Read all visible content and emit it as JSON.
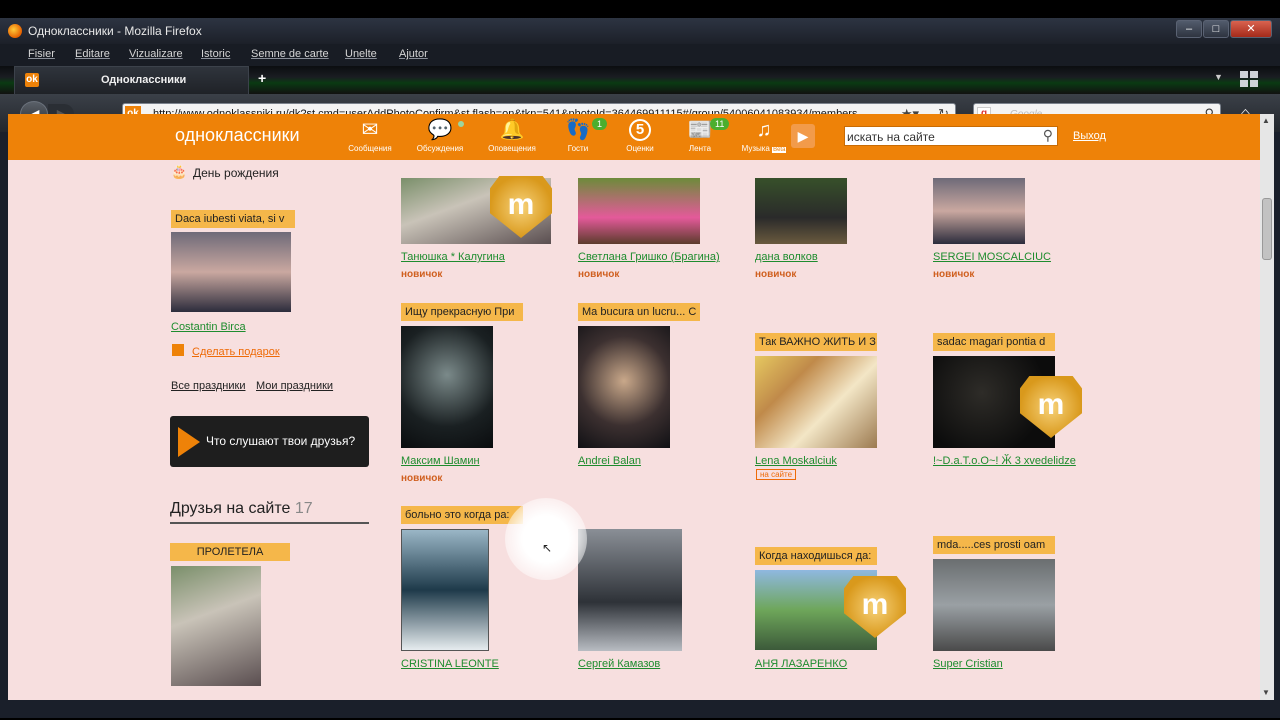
{
  "window": {
    "title": "Одноклассники - Mozilla Firefox"
  },
  "menu": [
    "Fisier",
    "Editare",
    "Vizualizare",
    "Istoric",
    "Semne de carte",
    "Unelte",
    "Ajutor"
  ],
  "tab": {
    "title": "Одноклассники",
    "new_tab": "+"
  },
  "nav": {
    "url": "http://www.odnoklassniki.ru/dk?st.cmd=userAddPhotoConfirm&st.flash=on&tkn=541&photoId=364469911115#/group/54006041083934/members",
    "search_placeholder": "Google"
  },
  "ok": {
    "logo": "одноклассники",
    "nav": [
      {
        "label": "Сообщения",
        "icon": "envelope-icon",
        "glyph": "✉"
      },
      {
        "label": "Обсуждения",
        "icon": "chat-icon",
        "glyph": "💬"
      },
      {
        "label": "Оповещения",
        "icon": "bell-icon",
        "glyph": "🔔"
      },
      {
        "label": "Гости",
        "icon": "footprints-icon",
        "glyph": "👣",
        "badge": "1"
      },
      {
        "label": "Оценки",
        "icon": "rating-icon",
        "glyph": "5"
      },
      {
        "label": "Лента",
        "icon": "feed-icon",
        "glyph": "📰",
        "badge": "11"
      },
      {
        "label": "Музыка",
        "icon": "music-icon",
        "glyph": "♫",
        "beta": "Beta"
      }
    ],
    "search_placeholder": "искать на сайте",
    "logout": "Выход"
  },
  "left": {
    "birthday": "День рождения",
    "caption1": "Daca iubesti viata, si v",
    "person1": "Costantin Birca",
    "gift": "Сделать подарок",
    "all_holidays": "Все праздники",
    "my_holidays": "Мои праздники",
    "music_btn": "Что слушают твои друзья?",
    "friends_title": "Друзья на сайте",
    "friends_count": "17",
    "flew": "ПРОЛЕТЕЛА"
  },
  "members": [
    {
      "name": "Танюшка * Калугина",
      "status": "новичок"
    },
    {
      "name": "Светлана Гришко (Брагина)",
      "status": "новичок"
    },
    {
      "name": "дана волков",
      "status": "новичок"
    },
    {
      "name": "SERGEI MOSCALCIUC",
      "status": "новичок"
    },
    {
      "caption": "Ищу прекрасную При",
      "name": "Максим Шамин",
      "status": "новичок"
    },
    {
      "caption": "Ma bucura un lucru... C",
      "name": "Andrei Balan"
    },
    {
      "caption": "Так ВАЖНО ЖИТЬ И З",
      "name": "Lena Moskalciuk",
      "status": "на сайте"
    },
    {
      "caption": "sadac magari pontia d",
      "name": "!~D.a.T.o.O~! Ӂ 3 xvedelidze"
    },
    {
      "caption": "больно это когда ра:",
      "name": "CRISTINA LEONTE"
    },
    {
      "name": "Сергей Камазов"
    },
    {
      "caption": "Когда находишься да:",
      "name": "АНЯ ЛАЗАРЕНКО"
    },
    {
      "caption": "mda.....ces prosti oam",
      "name": "Super Cristian"
    }
  ],
  "badge_letter": "m",
  "colors": {
    "ok_orange": "#ee8208",
    "page_bg": "#f7dfdf",
    "caption_bg": "#f5b74a",
    "link_green": "#1e8c2e"
  }
}
